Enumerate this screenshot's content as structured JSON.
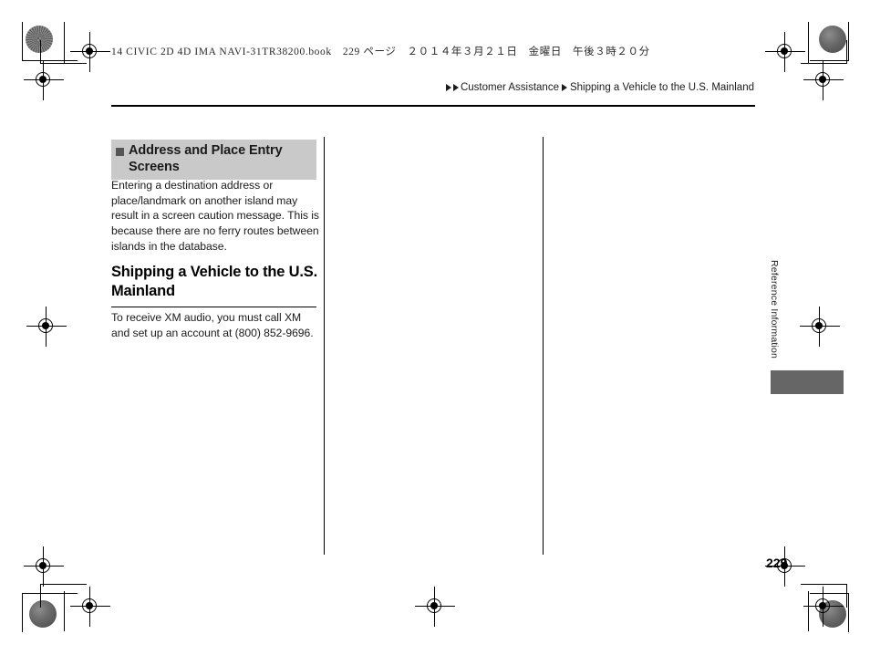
{
  "document": {
    "book_line": "14 CIVIC 2D 4D IMA NAVI-31TR38200.book　229 ページ　２０１４年３月２１日　金曜日　午後３時２０分",
    "page_number": "229",
    "running_head_vertical": "Reference Information"
  },
  "breadcrumb": {
    "marker_icon": "double-triangle-icon",
    "level1": "Customer Assistance",
    "separator_icon": "triangle-right-icon",
    "level2": "Shipping a Vehicle to the U.S. Mainland"
  },
  "sidebar_note": {
    "bullet_icon": "filled-square-icon",
    "heading": "Address and Place Entry Screens",
    "body": "Entering a destination address or place/landmark on another island may result in a screen caution message. This is because there are no ferry routes between islands in the database."
  },
  "main_section": {
    "title": "Shipping a Vehicle to the U.S. Mainland",
    "body": "To receive XM audio, you must call XM and set up an account at (800) 852-9696."
  },
  "colors": {
    "sidehead_background": "#c9c9c9",
    "thumb_tab": "#666666",
    "bullet_square": "#555555",
    "text": "#1a1a1a",
    "rules": "#000000"
  }
}
